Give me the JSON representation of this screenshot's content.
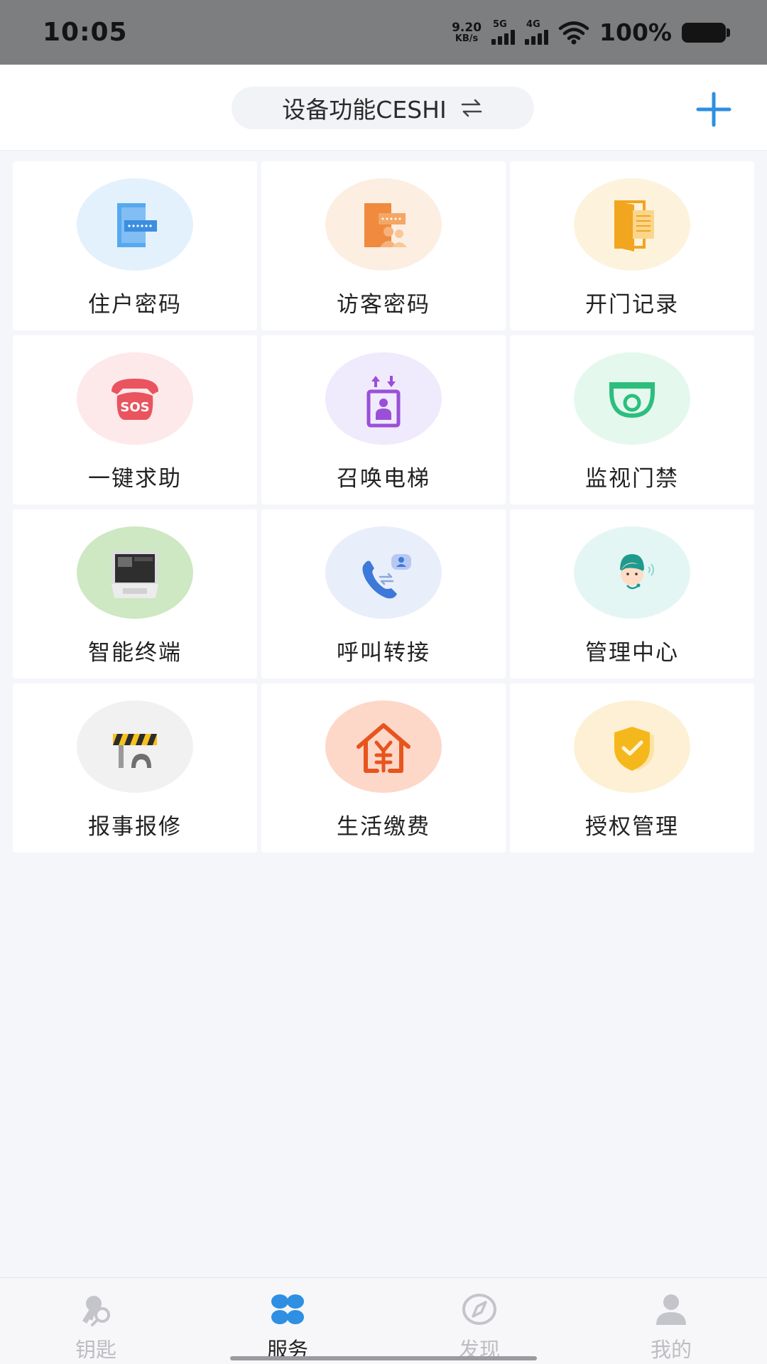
{
  "status_bar": {
    "time": "10:05",
    "net_speed_value": "9.20",
    "net_speed_unit": "KB/s",
    "signal1_label": "5G",
    "signal2_label": "4G",
    "battery_percent": "100%"
  },
  "header": {
    "device_name": "设备功能CESHI",
    "swap_icon": "swap-arrows-icon",
    "add_icon": "plus-icon",
    "accent_color": "#2f8fe0"
  },
  "tiles": [
    {
      "label": "住户密码",
      "icon": "resident-password-icon",
      "bg": "#e3f1fd"
    },
    {
      "label": "访客密码",
      "icon": "visitor-password-icon",
      "bg": "#fdeee2"
    },
    {
      "label": "开门记录",
      "icon": "door-record-icon",
      "bg": "#fdf3dc"
    },
    {
      "label": "一键求助",
      "icon": "sos-phone-icon",
      "bg": "#fde8ea"
    },
    {
      "label": "召唤电梯",
      "icon": "elevator-icon",
      "bg": "#efeafc"
    },
    {
      "label": "监视门禁",
      "icon": "camera-icon",
      "bg": "#e4f8ee"
    },
    {
      "label": "智能终端",
      "icon": "smart-terminal-icon",
      "bg": "#cde8c2"
    },
    {
      "label": "呼叫转接",
      "icon": "call-transfer-icon",
      "bg": "#e9eefb"
    },
    {
      "label": "管理中心",
      "icon": "service-agent-icon",
      "bg": "#e4f6f3"
    },
    {
      "label": "报事报修",
      "icon": "repair-barrier-icon",
      "bg": "#f1f1f1"
    },
    {
      "label": "生活缴费",
      "icon": "payment-house-icon",
      "bg": "#fdd8c8"
    },
    {
      "label": "授权管理",
      "icon": "authorization-shield-icon",
      "bg": "#fdf0d5"
    }
  ],
  "bottom_nav": [
    {
      "label": "钥匙",
      "icon": "key-icon",
      "active": false
    },
    {
      "label": "服务",
      "icon": "service-grid-icon",
      "active": true
    },
    {
      "label": "发现",
      "icon": "compass-icon",
      "active": false
    },
    {
      "label": "我的",
      "icon": "profile-icon",
      "active": false
    }
  ]
}
